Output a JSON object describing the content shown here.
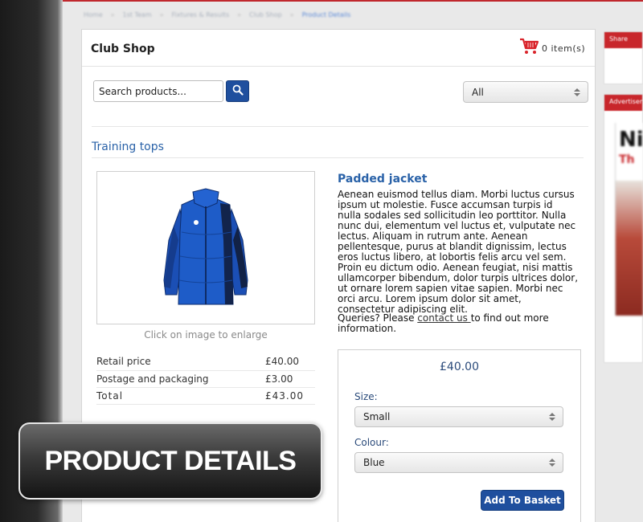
{
  "breadcrumb": {
    "items": [
      "Home",
      "1st Team",
      "Fixtures & Results",
      "Club Shop"
    ],
    "current": "Product Details"
  },
  "shop": {
    "title": "Club Shop",
    "cart_count": "0 item(s)"
  },
  "search": {
    "placeholder": "Search products...",
    "category_value": "All"
  },
  "section": {
    "heading": "Training tops"
  },
  "product": {
    "name": "Padded jacket",
    "description": "Aenean euismod tellus diam. Morbi luctus cursus ipsum ut molestie. Fusce accumsan turpis id nulla sodales sed sollicitudin leo porttitor. Nulla nunc dui, elementum vel luctus et, vulputate nec lectus. Aliquam in rutrum ante. Aenean pellentesque, purus at blandit dignissim, lectus eros luctus libero, at lobortis felis arcu vel sem. Proin eu dictum odio. Aenean feugiat, nisi mattis ullamcorper bibendum, dolor turpis ultrices dolor, ut ornare lorem sapien vitae sapien. Morbi nec orci arcu. Lorem ipsum dolor sit amet, consectetur adipiscing elit.",
    "queries_prefix": "Queries? Please ",
    "queries_link": "contact us ",
    "queries_suffix": "to find out more information.",
    "image_caption": "Click on image to enlarge",
    "price_rows": [
      {
        "label": "Retail price",
        "value": "£40.00"
      },
      {
        "label": "Postage and packaging",
        "value": "£3.00"
      },
      {
        "label": "Total",
        "value": "£43.00"
      }
    ]
  },
  "purchase": {
    "price": "£40.00",
    "size_label": "Size:",
    "size_value": "Small",
    "colour_label": "Colour:",
    "colour_value": "Blue",
    "add_button": "Add To Basket"
  },
  "sidebar": {
    "share_title": "Share",
    "ad_title": "Advertisement",
    "ad_big": "Ni",
    "ad_sub": "Th"
  },
  "overlay": {
    "text": "PRODUCT DETAILS"
  },
  "colors": {
    "accent_blue": "#1f4f9e",
    "heading_blue": "#2a62a8",
    "cart_red": "#d9232a",
    "header_red": "#c8262b"
  }
}
